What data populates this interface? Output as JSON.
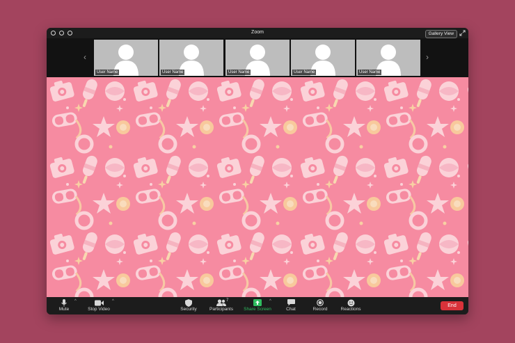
{
  "window": {
    "title": "Zoom",
    "gallery_view_label": "Gallery View"
  },
  "participants_strip": {
    "tiles": [
      {
        "name": "User Name"
      },
      {
        "name": "User Name"
      },
      {
        "name": "User Name"
      },
      {
        "name": "User Name"
      },
      {
        "name": "User Name"
      }
    ]
  },
  "toolbar": {
    "mute": "Mute",
    "stop_video": "Stop Video",
    "security": "Security",
    "participants": "Participants",
    "participants_count": "7",
    "share_screen": "Share Screen",
    "chat": "Chat",
    "record": "Record",
    "reactions": "Reactions",
    "end": "End"
  },
  "colors": {
    "desktop_bg": "#a3445e",
    "window_bg": "#1c1c1c",
    "video_pattern_bg": "#f68ba1",
    "share_green": "#2fbd5f",
    "end_red": "#d9323a"
  }
}
